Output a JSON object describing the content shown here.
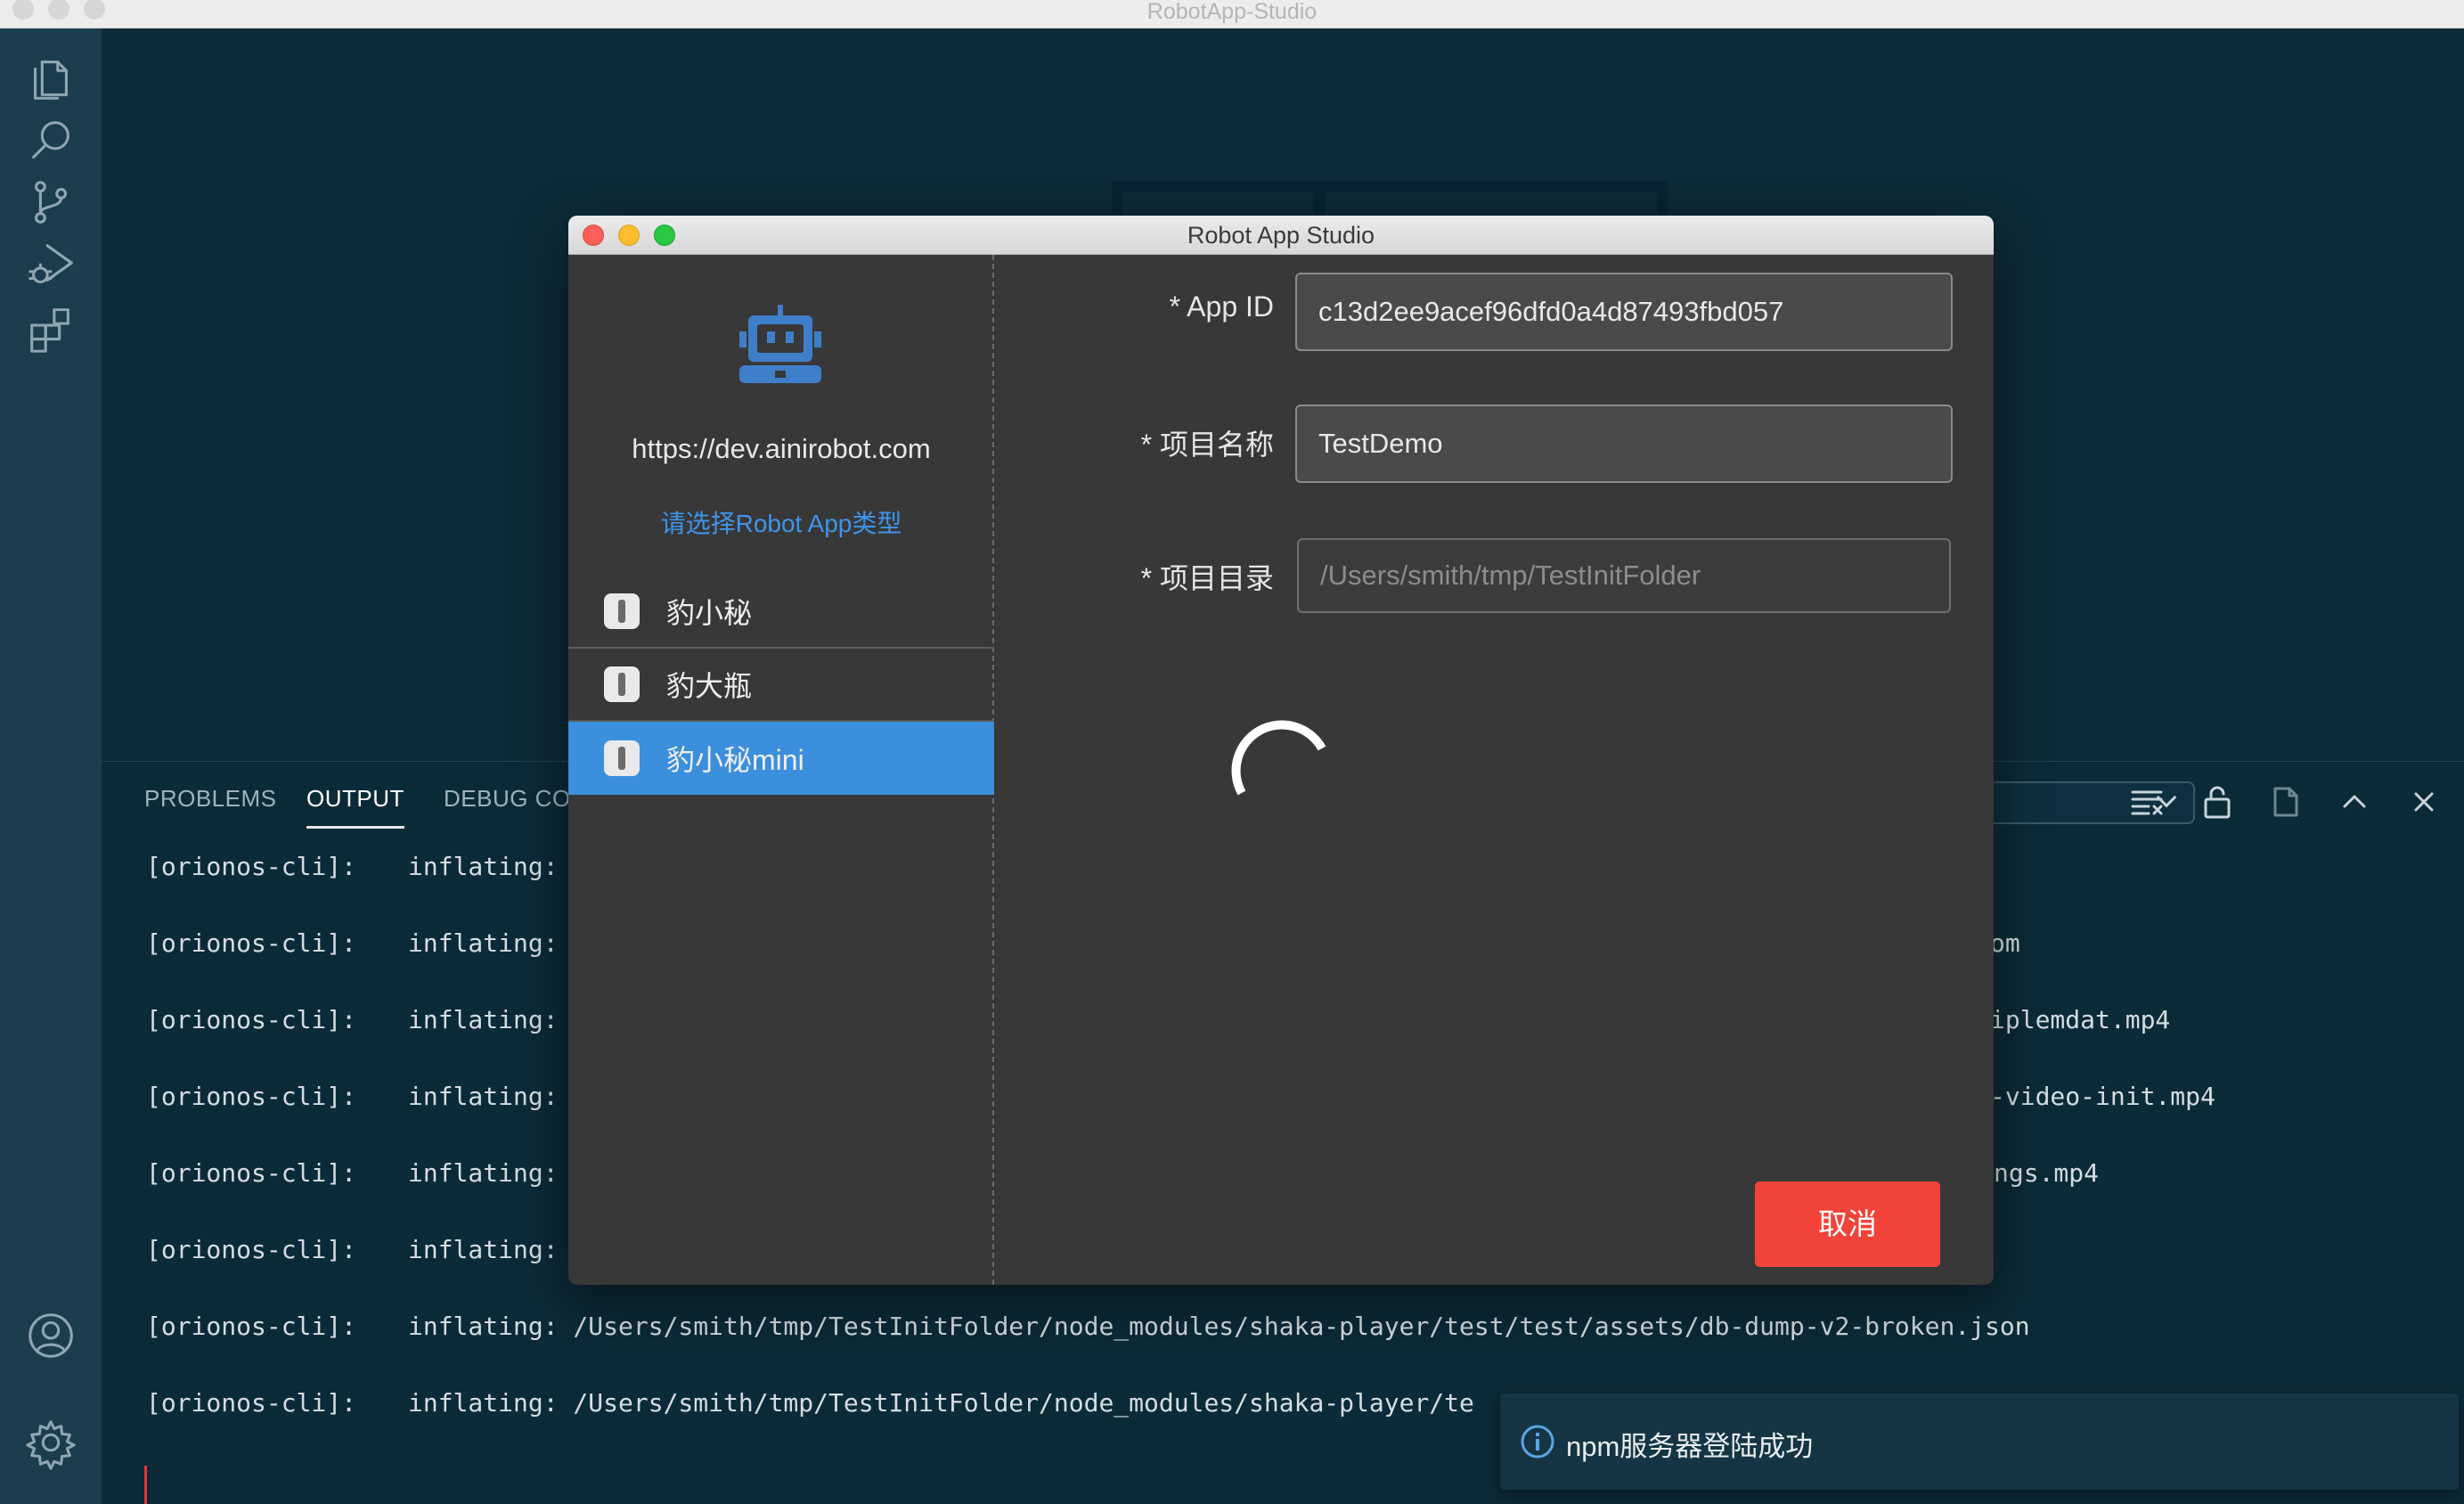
{
  "window": {
    "title": "RobotApp-Studio"
  },
  "activity_bar": {
    "items": [
      {
        "name": "files-icon"
      },
      {
        "name": "search-icon"
      },
      {
        "name": "source-control-icon"
      },
      {
        "name": "run-debug-icon"
      },
      {
        "name": "extensions-icon"
      },
      {
        "name": "account-icon"
      },
      {
        "name": "settings-gear-icon"
      }
    ]
  },
  "panel": {
    "tabs": [
      {
        "label": "PROBLEMS",
        "active": false
      },
      {
        "label": "OUTPUT",
        "active": true
      },
      {
        "label": "DEBUG CON",
        "active": false
      }
    ],
    "output_lines": [
      {
        "prefix": "[orionos-cli]:",
        "text": "inflating:",
        "tail": ""
      },
      {
        "prefix": "[orionos-cli]:",
        "text": "inflating:",
        "tail": "om"
      },
      {
        "prefix": "[orionos-cli]:",
        "text": "inflating:",
        "tail": "iplemdat.mp4"
      },
      {
        "prefix": "[orionos-cli]:",
        "text": "inflating:",
        "tail": "-video-init.mp4"
      },
      {
        "prefix": "[orionos-cli]:",
        "text": "inflating:",
        "tail": "ngs.mp4"
      },
      {
        "prefix": "[orionos-cli]:",
        "text": "inflating:",
        "tail": ""
      },
      {
        "prefix": "[orionos-cli]:",
        "text": "inflating: /Users/smith/tmp/TestInitFolder/node_modules/shaka-player/test/test/assets/db-dump-v2-broken.json",
        "tail": ""
      },
      {
        "prefix": "[orionos-cli]:",
        "text": "inflating: /Users/smith/tmp/TestInitFolder/node_modules/shaka-player/te",
        "tail": ""
      }
    ]
  },
  "dialog": {
    "title": "Robot App Studio",
    "dev_url": "https://dev.ainirobot.com",
    "choose_type_label": "请选择Robot App类型",
    "app_types": [
      {
        "label": "豹小秘",
        "selected": false
      },
      {
        "label": "豹大瓶",
        "selected": false
      },
      {
        "label": "豹小秘mini",
        "selected": true
      }
    ],
    "form": {
      "app_id_label": "* App ID",
      "app_id_value": "c13d2ee9acef96dfd0a4d87493fbd057",
      "project_name_label": "* 项目名称",
      "project_name_value": "TestDemo",
      "project_dir_label": "* 项目目录",
      "project_dir_placeholder": "/Users/smith/tmp/TestInitFolder"
    },
    "cancel_label": "取消"
  },
  "notification": {
    "message": "npm服务器登陆成功"
  },
  "colors": {
    "accent_blue": "#3c8fdc",
    "cancel_red": "#f2433a",
    "editor_bg": "#0d2b38",
    "activity_bg": "#1b3d4d"
  }
}
